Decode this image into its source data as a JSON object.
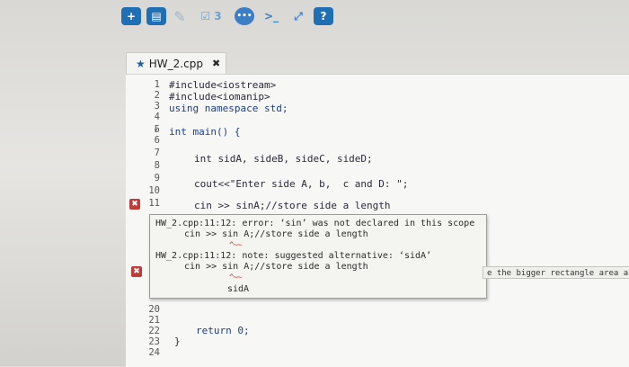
{
  "toolbar": {
    "new_icon": "+",
    "save_icon": "▤",
    "edit_icon": "✎",
    "run_label": "☑ 3",
    "chat_icon": "•••",
    "terminal_icon": ">_",
    "expand_icon": "⤢",
    "help_label": "?"
  },
  "tab": {
    "star": "★",
    "filename": "HW_2.cpp",
    "close": "✖"
  },
  "editor": {
    "line_numbers": [
      "1",
      "2",
      "3",
      "4",
      "5",
      "6",
      "7",
      "8",
      "9",
      "10",
      "11",
      "20",
      "21",
      "22",
      "23",
      "24"
    ],
    "lines": {
      "l1": "#include<iostream>",
      "l2": "#include<iomanip>",
      "l3": "using namespace std;",
      "l5": "int main() {",
      "l7": "int sidA, sideB, sideC, sideD;",
      "l9": "cout<<\"Enter side A, b,  c and D: \";",
      "l11": "cin >> sinA;//store side a length",
      "l22": "return 0;",
      "l23": "}"
    },
    "fold_marker": "▾",
    "error_marker": "✖"
  },
  "tooltip": {
    "error_line": "HW_2.cpp:11:12: error: ‘sin’ was not declared in this scope",
    "error_code": "cin >> sin A;//store side a length",
    "error_squiggle": "^~~",
    "note_line": "HW_2.cpp:11:12: note: suggested alternative: ‘sidA’",
    "note_code": "cin >> sin A;//store side a length",
    "note_squiggle": "^~~",
    "suggestion": "sidA"
  },
  "side_note": "e the bigger rectangle area a"
}
